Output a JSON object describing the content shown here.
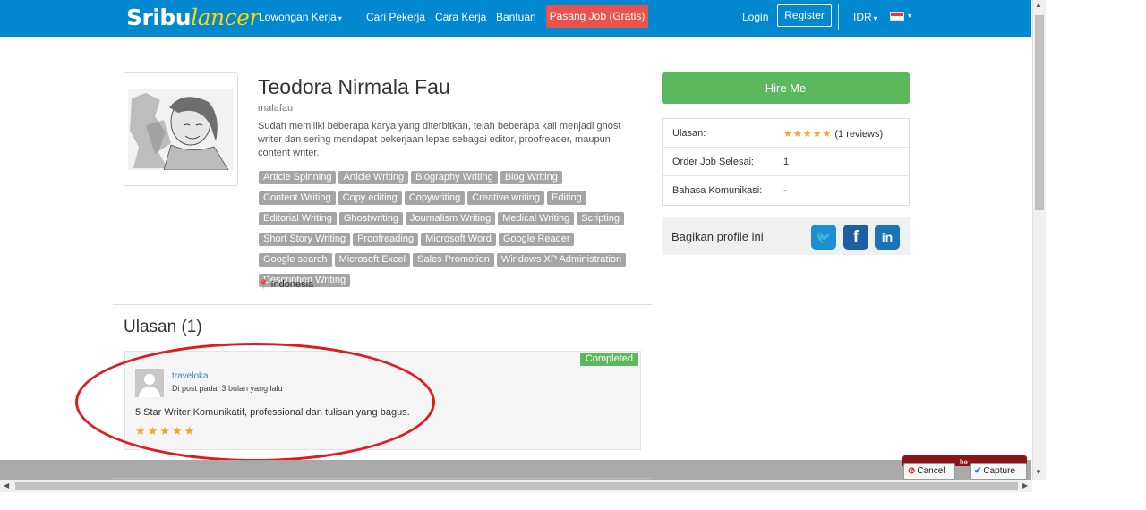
{
  "navbar": {
    "logo_part1": "Sribu",
    "logo_part2": "lancer",
    "lowongan": "Lowongan Kerja",
    "cari": "Cari Pekerja",
    "cara": "Cara Kerja",
    "bantuan": "Bantuan",
    "pasang": "Pasang Job (Gratis)",
    "login": "Login",
    "register": "Register",
    "currency": "IDR"
  },
  "profile": {
    "name": "Teodora Nirmala Fau",
    "username": "malafau",
    "bio": "Sudah memiliki beberapa karya yang diterbitkan, telah beberapa kali menjadi ghost writer dan sering mendapat pekerjaan lepas sebagai editor, proofreader, maupun content writer.",
    "tags": [
      "Article Spinning",
      "Article Writing",
      "Biography Writing",
      "Blog Writing",
      "Content Writing",
      "Copy editing",
      "Copywriting",
      "Creative writing",
      "Editing",
      "Editorial Writing",
      "Ghostwriting",
      "Journalism Writing",
      "Medical Writing",
      "Scripting",
      "Short Story Writing",
      "Proofreading",
      "Microsoft Word",
      "Google Reader",
      "Google search",
      "Microsoft Excel",
      "Sales Promotion",
      "Windows XP Administration",
      "Description Writing"
    ],
    "location": "Indonesia"
  },
  "side": {
    "hire": "Hire Me",
    "ulasan_label": "Ulasan:",
    "ulasan_stars": "★★★★★",
    "ulasan_count": "(1 reviews)",
    "order_label": "Order Job Selesai:",
    "order_value": "1",
    "bahasa_label": "Bahasa Komunikasi:",
    "bahasa_value": "-",
    "share_label": "Bagikan profile ini"
  },
  "reviews": {
    "title": "Ulasan (1)",
    "items": [
      {
        "badge": "Completed",
        "user": "traveloka",
        "date": "Di post pada: 3 bulan yang lalu",
        "text": "5 Star Writer Komunikatif, professional dan tulisan yang bagus.",
        "stars": "★★★★★"
      }
    ]
  },
  "extension": {
    "cancel": "Cancel",
    "capture": "Capture",
    "partial": "he"
  },
  "colors": {
    "navbar": "#0288d1",
    "accent_red": "#e9534d",
    "hire_green": "#5cb85c",
    "star": "#f0a828",
    "annotation_red": "#e01b1b"
  }
}
